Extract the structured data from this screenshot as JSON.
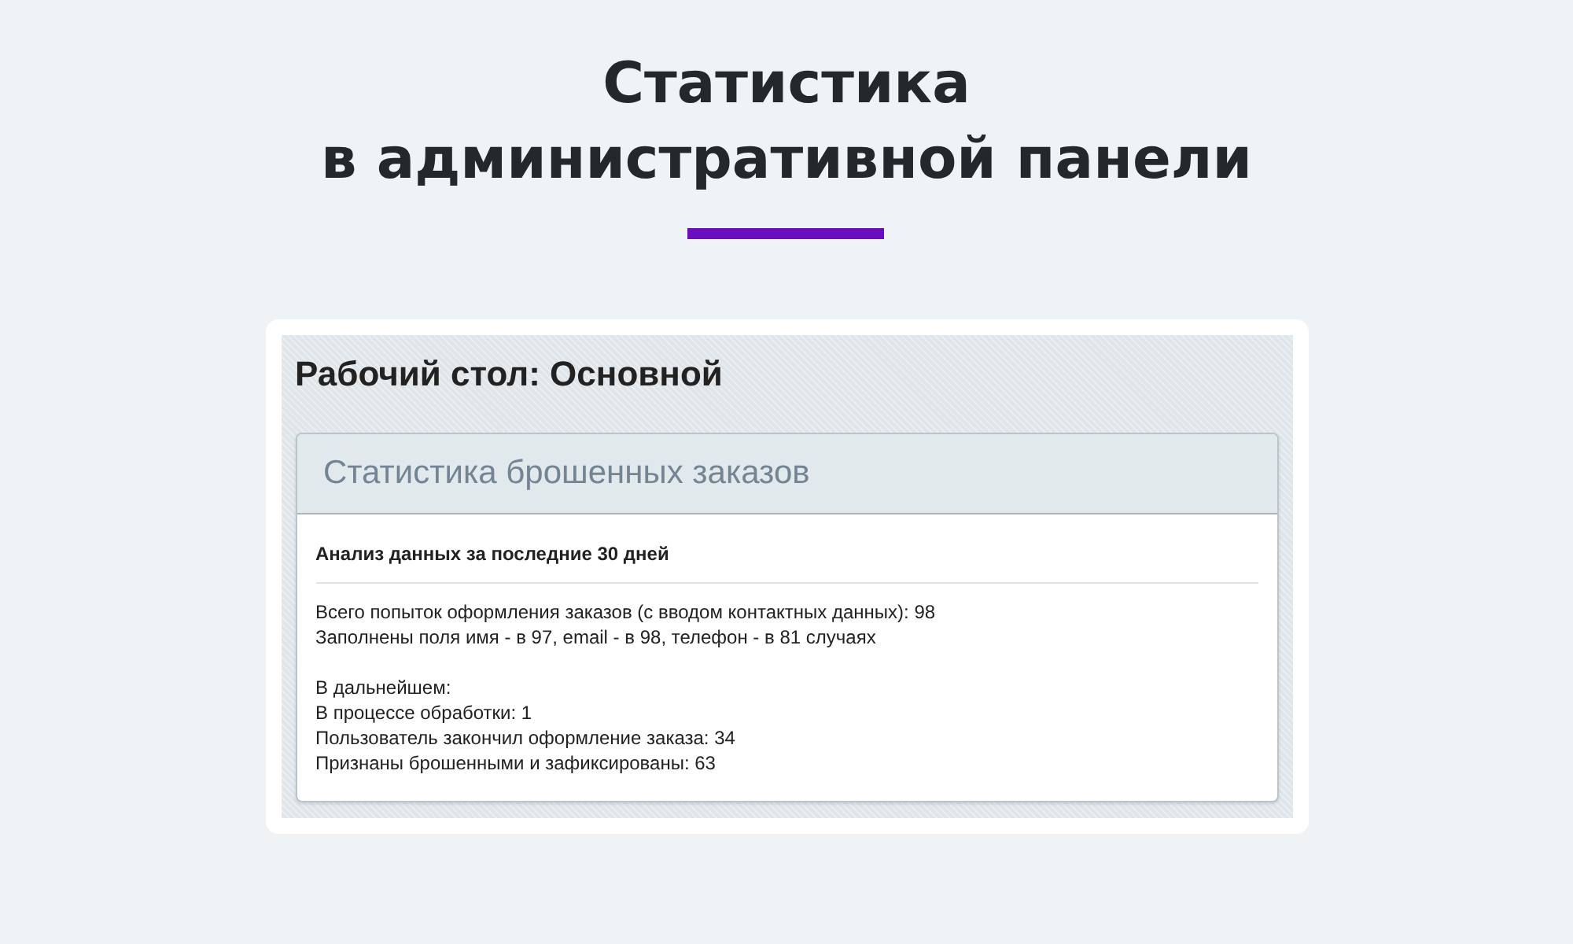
{
  "heading": {
    "lines": [
      "Статистика",
      "в административной панели"
    ]
  },
  "dashboard": {
    "title": "Рабочий стол: Основной",
    "widget": {
      "title": "Статистика брошенных заказов",
      "subtitle": "Анализ данных за последние 30 дней",
      "paragraphs": [
        [
          "Всего попыток оформления заказов (с вводом контактных данных): 98",
          "Заполнены поля имя - в 97, email - в 98, телефон - в 81 случаях"
        ],
        [
          "В дальнейшем:",
          "В процессе обработки: 1",
          "Пользователь закончил оформление заказа: 34",
          "Признаны брошенными и зафиксированы: 63"
        ]
      ]
    }
  }
}
